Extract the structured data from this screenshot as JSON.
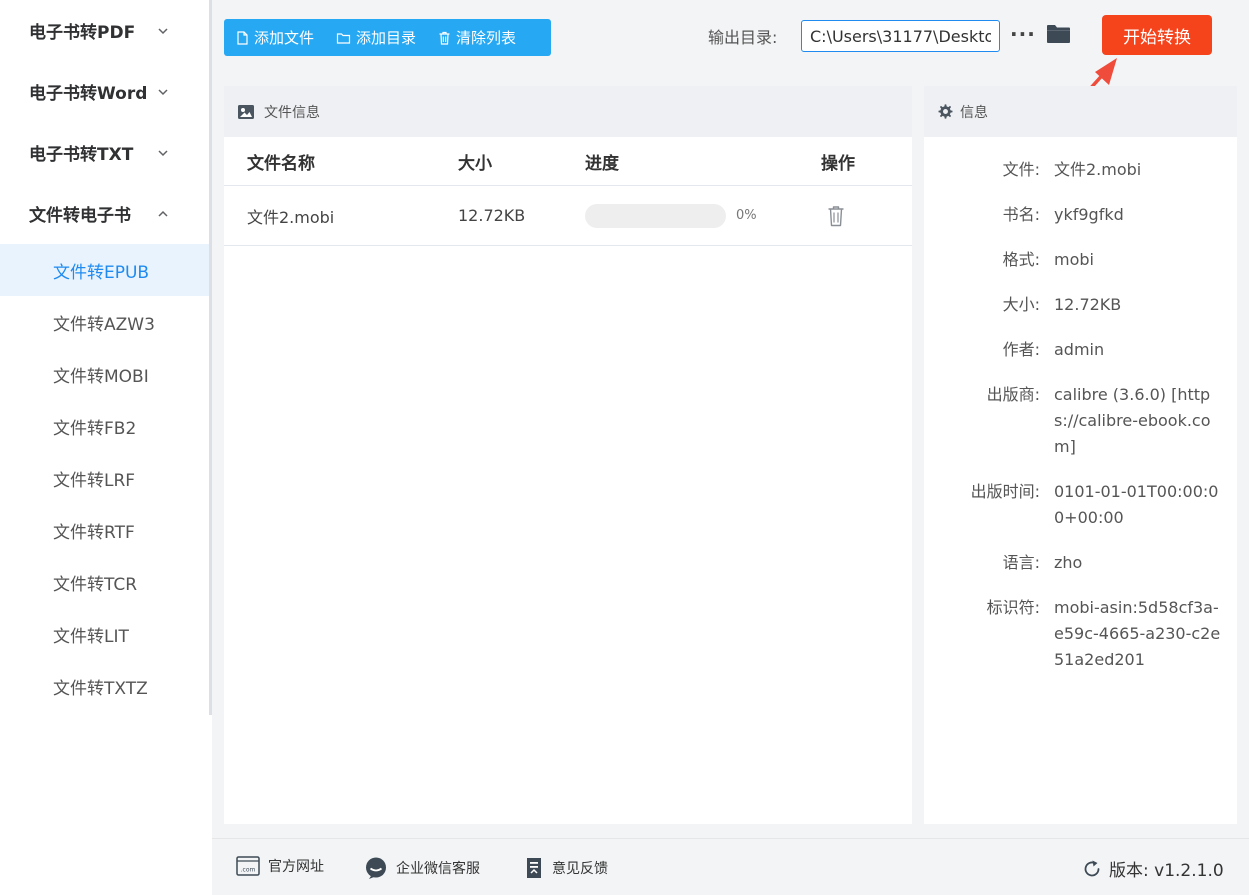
{
  "sidebar": {
    "groups": [
      {
        "label": "电子书转PDF",
        "expanded": false
      },
      {
        "label": "电子书转Word",
        "expanded": false
      },
      {
        "label": "电子书转TXT",
        "expanded": false
      },
      {
        "label": "文件转电子书",
        "expanded": true
      }
    ],
    "subitems": [
      {
        "label": "文件转EPUB",
        "active": true
      },
      {
        "label": "文件转AZW3"
      },
      {
        "label": "文件转MOBI"
      },
      {
        "label": "文件转FB2"
      },
      {
        "label": "文件转LRF"
      },
      {
        "label": "文件转RTF"
      },
      {
        "label": "文件转TCR"
      },
      {
        "label": "文件转LIT"
      },
      {
        "label": "文件转TXTZ"
      }
    ]
  },
  "toolbar": {
    "add_file": "添加文件",
    "add_dir": "添加目录",
    "clear_list": "清除列表",
    "output_label": "输出目录:",
    "output_path": "C:\\Users\\31177\\Deskto",
    "more": "···",
    "start": "开始转换"
  },
  "file_panel": {
    "title": "文件信息",
    "columns": {
      "name": "文件名称",
      "size": "大小",
      "progress": "进度",
      "action": "操作"
    },
    "rows": [
      {
        "name": "文件2.mobi",
        "size": "12.72KB",
        "progress": 0,
        "progress_label": "0%"
      }
    ]
  },
  "info_panel": {
    "title": "信息",
    "fields": [
      {
        "key": "文件:",
        "value": "文件2.mobi"
      },
      {
        "key": "书名:",
        "value": "ykf9gfkd"
      },
      {
        "key": "格式:",
        "value": "mobi"
      },
      {
        "key": "大小:",
        "value": "12.72KB"
      },
      {
        "key": "作者:",
        "value": "admin"
      },
      {
        "key": "出版商:",
        "value": "calibre (3.6.0) [https://calibre-ebook.com]"
      },
      {
        "key": "出版时间:",
        "value": "0101-01-01T00:00:00+00:00"
      },
      {
        "key": "语言:",
        "value": "zho"
      },
      {
        "key": "标识符:",
        "value": "mobi-asin:5d58cf3a-e59c-4665-a230-c2e51a2ed201"
      }
    ]
  },
  "footer": {
    "website": "官方网址",
    "wechat": "企业微信客服",
    "feedback": "意见反馈",
    "version": "版本: v1.2.1.0"
  },
  "colors": {
    "accent": "#27a8f3",
    "active_text": "#1f8bf0",
    "start_button": "#f5431c",
    "arrow": "#f04c3c"
  },
  "icons": [
    "chevron-down-icon",
    "chevron-up-icon",
    "file-icon",
    "folder-outline-icon",
    "trash-icon",
    "folder-icon",
    "image-icon",
    "gear-icon",
    "website-icon",
    "chat-icon",
    "feedback-icon",
    "refresh-icon",
    "arrow-annotation"
  ]
}
